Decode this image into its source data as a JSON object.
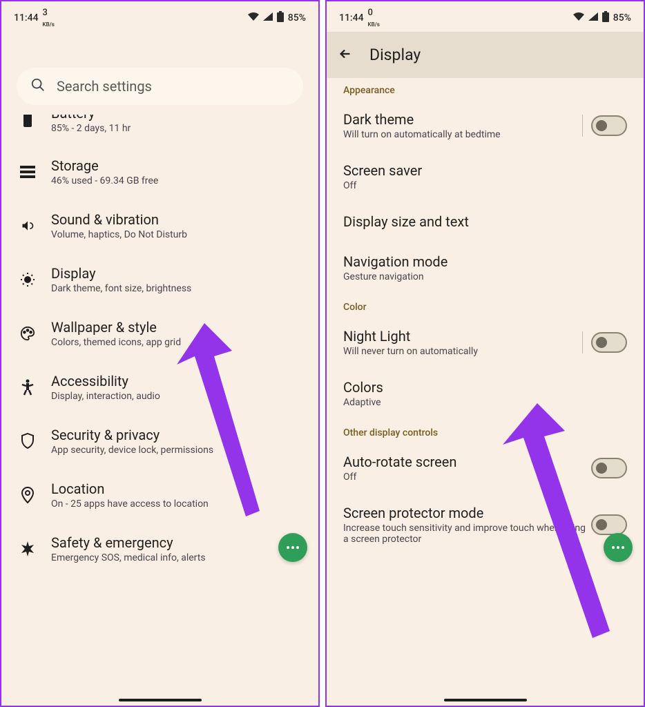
{
  "status": {
    "time": "11:44",
    "kbs_left": "3",
    "kbs_right": "0",
    "kbs_label": "KB/s",
    "battery": "85%"
  },
  "left": {
    "search_placeholder": "Search settings",
    "items": [
      {
        "icon": "battery",
        "title": "Battery",
        "sub": "85% - 2 days, 11 hr"
      },
      {
        "icon": "storage",
        "title": "Storage",
        "sub": "46% used - 69.34 GB free"
      },
      {
        "icon": "sound",
        "title": "Sound & vibration",
        "sub": "Volume, haptics, Do Not Disturb"
      },
      {
        "icon": "display",
        "title": "Display",
        "sub": "Dark theme, font size, brightness"
      },
      {
        "icon": "wallpaper",
        "title": "Wallpaper & style",
        "sub": "Colors, themed icons, app grid"
      },
      {
        "icon": "accessibility",
        "title": "Accessibility",
        "sub": "Display, interaction, audio"
      },
      {
        "icon": "security",
        "title": "Security & privacy",
        "sub": "App security, device lock, permissions"
      },
      {
        "icon": "location",
        "title": "Location",
        "sub": "On - 25 apps have access to location"
      },
      {
        "icon": "safety",
        "title": "Safety & emergency",
        "sub": "Emergency SOS, medical info, alerts"
      }
    ]
  },
  "right": {
    "page_title": "Display",
    "sections": {
      "appearance": "Appearance",
      "color": "Color",
      "other": "Other display controls"
    },
    "items": {
      "dark_theme": {
        "title": "Dark theme",
        "sub": "Will turn on automatically at bedtime",
        "toggle": false,
        "divider": true
      },
      "screen_saver": {
        "title": "Screen saver",
        "sub": "Off"
      },
      "display_size": {
        "title": "Display size and text",
        "sub": ""
      },
      "nav_mode": {
        "title": "Navigation mode",
        "sub": "Gesture navigation"
      },
      "night_light": {
        "title": "Night Light",
        "sub": "Will never turn on automatically",
        "toggle": false,
        "divider": true
      },
      "colors": {
        "title": "Colors",
        "sub": "Adaptive"
      },
      "auto_rotate": {
        "title": "Auto-rotate screen",
        "sub": "Off",
        "toggle": false
      },
      "screen_protector": {
        "title": "Screen protector mode",
        "sub": "Increase touch sensitivity and improve touch when using a screen protector",
        "toggle": false
      }
    }
  }
}
